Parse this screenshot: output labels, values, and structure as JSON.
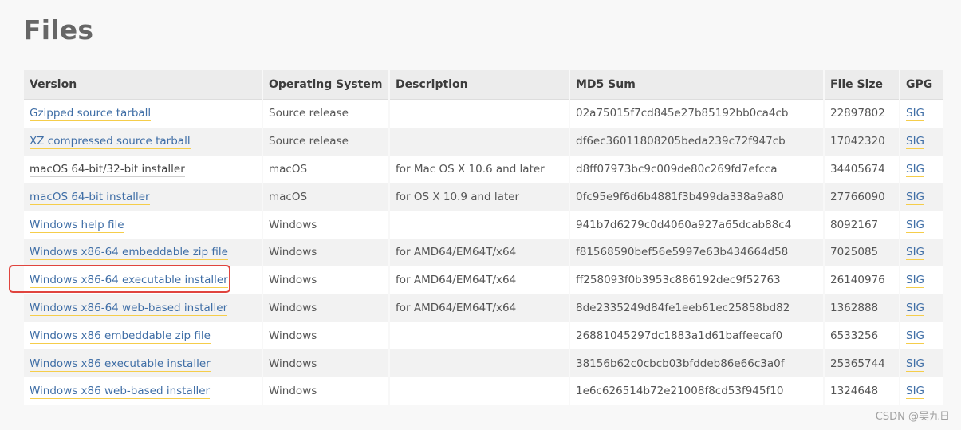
{
  "title": "Files",
  "headers": {
    "version": "Version",
    "os": "Operating System",
    "description": "Description",
    "md5": "MD5 Sum",
    "size": "File Size",
    "gpg": "GPG"
  },
  "rows": [
    {
      "version": "Gzipped source tarball",
      "os": "Source release",
      "description": "",
      "md5": "02a75015f7cd845e27b85192bb0ca4cb",
      "size": "22897802",
      "gpg": "SIG"
    },
    {
      "version": "XZ compressed source tarball",
      "os": "Source release",
      "description": "",
      "md5": "df6ec36011808205beda239c72f947cb",
      "size": "17042320",
      "gpg": "SIG"
    },
    {
      "version": "macOS 64-bit/32-bit installer",
      "os": "macOS",
      "description": "for Mac OS X 10.6 and later",
      "md5": "d8ff07973bc9c009de80c269fd7efcca",
      "size": "34405674",
      "gpg": "SIG"
    },
    {
      "version": "macOS 64-bit installer",
      "os": "macOS",
      "description": "for OS X 10.9 and later",
      "md5": "0fc95e9f6d6b4881f3b499da338a9a80",
      "size": "27766090",
      "gpg": "SIG"
    },
    {
      "version": "Windows help file",
      "os": "Windows",
      "description": "",
      "md5": "941b7d6279c0d4060a927a65dcab88c4",
      "size": "8092167",
      "gpg": "SIG"
    },
    {
      "version": "Windows x86-64 embeddable zip file",
      "os": "Windows",
      "description": "for AMD64/EM64T/x64",
      "md5": "f81568590bef56e5997e63b434664d58",
      "size": "7025085",
      "gpg": "SIG"
    },
    {
      "version": "Windows x86-64 executable installer",
      "os": "Windows",
      "description": "for AMD64/EM64T/x64",
      "md5": "ff258093f0b3953c886192dec9f52763",
      "size": "26140976",
      "gpg": "SIG"
    },
    {
      "version": "Windows x86-64 web-based installer",
      "os": "Windows",
      "description": "for AMD64/EM64T/x64",
      "md5": "8de2335249d84fe1eeb61ec25858bd82",
      "size": "1362888",
      "gpg": "SIG"
    },
    {
      "version": "Windows x86 embeddable zip file",
      "os": "Windows",
      "description": "",
      "md5": "26881045297dc1883a1d61baffeecaf0",
      "size": "6533256",
      "gpg": "SIG"
    },
    {
      "version": "Windows x86 executable installer",
      "os": "Windows",
      "description": "",
      "md5": "38156b62c0cbcb03bfddeb86e66c3a0f",
      "size": "25365744",
      "gpg": "SIG"
    },
    {
      "version": "Windows x86 web-based installer",
      "os": "Windows",
      "description": "",
      "md5": "1e6c626514b72e21008f8cd53f945f10",
      "size": "1324648",
      "gpg": "SIG"
    }
  ],
  "watermark": "CSDN @吴九日",
  "colors": {
    "link": "#3f6ea6",
    "link_underline": "#f5cd4a",
    "highlight": "#e0443e"
  }
}
